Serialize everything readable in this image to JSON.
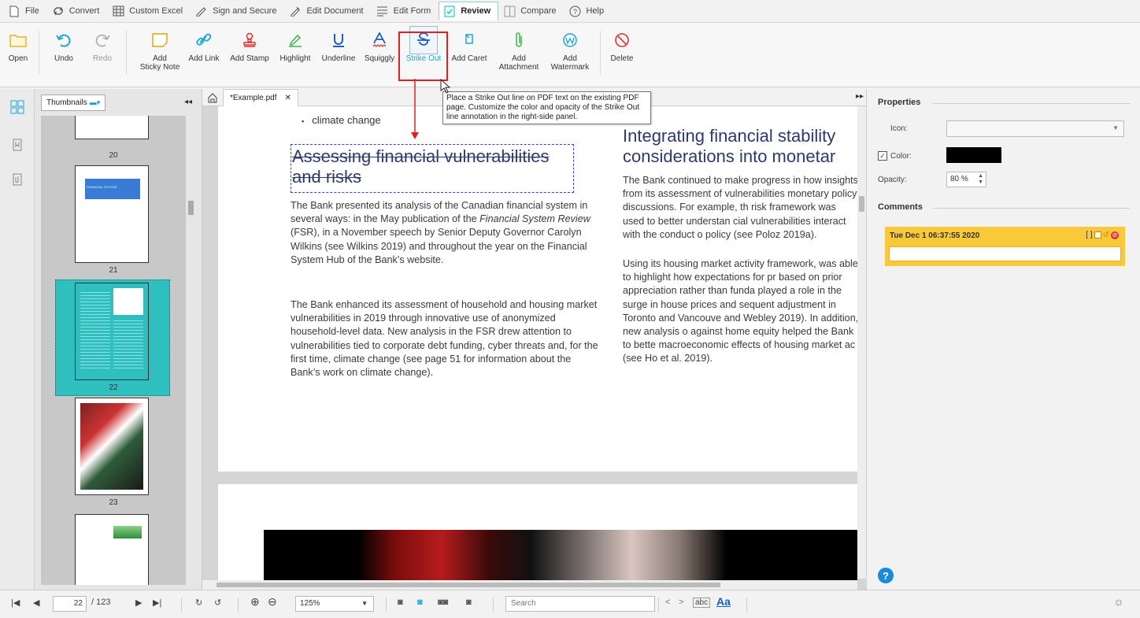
{
  "menubar": {
    "items": [
      {
        "label": "File",
        "icon": "file-icon"
      },
      {
        "label": "Convert",
        "icon": "convert-icon"
      },
      {
        "label": "Custom Excel",
        "icon": "excel-icon"
      },
      {
        "label": "Sign and Secure",
        "icon": "sign-icon"
      },
      {
        "label": "Edit Document",
        "icon": "edit-document-icon"
      },
      {
        "label": "Edit Form",
        "icon": "edit-form-icon"
      },
      {
        "label": "Review",
        "icon": "review-icon",
        "active": true
      },
      {
        "label": "Compare",
        "icon": "compare-icon"
      },
      {
        "label": "Help",
        "icon": "help-icon"
      }
    ]
  },
  "ribbon": {
    "open": "Open",
    "undo": "Undo",
    "redo": "Redo",
    "sticky_note": "Add\nSticky Note",
    "link": "Add Link",
    "stamp": "Add Stamp",
    "highlight": "Highlight",
    "underline": "Underline",
    "squiggly": "Squiggly",
    "strikeout": "Strike Out",
    "caret": "Add Caret",
    "attachment": "Add\nAttachment",
    "watermark": "Add\nWatermark",
    "delete": "Delete"
  },
  "tooltip": "Place a Strike Out line on PDF text on the existing PDF page. Customize the color and opacity of the Strike Out line annotation in the right-side panel.",
  "thumbnails": {
    "mode": "Thumbnails",
    "pages": [
      "20",
      "21",
      "22",
      "23"
    ],
    "thumb21_banner": "FINANCIAL SYSTEM"
  },
  "document": {
    "tab_title": "*Example.pdf",
    "bullet": "climate change",
    "left_heading": "Assessing financial vulnerabilities and risks",
    "left_para1_a": "The Bank presented its analysis of the Canadian financial system in several ways: in the May publication of the ",
    "left_para1_em": "Financial System Review",
    "left_para1_b": " (FSR), in a November speech by Senior Deputy Governor Carolyn Wilkins (see Wilkins 2019) and throughout the year on the Financial System Hub of the Bank’s website.",
    "left_para2": "The Bank enhanced its assessment of household and housing market vulnerabilities in 2019 through innovative use of anonymized household-level data. New analysis in the FSR drew attention to vulnerabilities tied to corporate debt funding, cyber threats and, for the first time, climate change (see page 51 for information about the Bank’s work on climate change).",
    "right_heading_l1": "Integrating financial stability",
    "right_heading_l2": "considerations into monetar",
    "right_para1": "The Bank continued to make progress in how insights from its assessment of vulnerabilities monetary policy discussions. For example, th risk framework was used to better understan cial vulnerabilities interact with the conduct o policy (see Poloz 2019a).",
    "right_para2": "Using its housing market activity framework, was able to highlight how expectations for pr based on prior appreciation rather than funda played a role in the surge in house prices and sequent adjustment in Toronto and Vancouve and Webley 2019). In addition, new analysis o against home equity helped the Bank to bette macroeconomic effects of housing market ac (see Ho et al. 2019)."
  },
  "properties": {
    "title": "Properties",
    "icon_label": "Icon:",
    "color_label": "Color:",
    "color_value": "#000000",
    "opacity_label": "Opacity:",
    "opacity_value": "80 %",
    "comments_title": "Comments",
    "comment_date": "Tue Dec 1 06:37:55 2020"
  },
  "statusbar": {
    "page_current": "22",
    "page_total": "/ 123",
    "zoom": "125%",
    "search_placeholder": "Search",
    "match_word": "abc",
    "match_case": "Aa"
  },
  "colors": {
    "accent": "#2fbfbf",
    "highlight_red": "#e02020",
    "heading_blue": "#2d3a6b",
    "comment_yellow": "#f9c93a"
  }
}
